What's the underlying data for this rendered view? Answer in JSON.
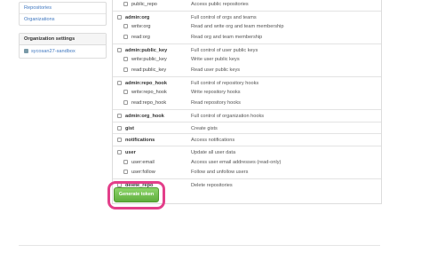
{
  "sidebar": {
    "nav_items": [
      "Repositories",
      "Organizations"
    ],
    "org_settings": {
      "heading": "Organization settings",
      "orgs": [
        "sycosan27-sandbox"
      ]
    }
  },
  "scopes": [
    {
      "name": "public_repo",
      "description": "Access public repositories",
      "level": "child"
    },
    {
      "name": "admin:org",
      "description": "Full control of orgs and teams",
      "level": "parent"
    },
    {
      "name": "write:org",
      "description": "Read and write org and team membership",
      "level": "child"
    },
    {
      "name": "read:org",
      "description": "Read org and team membership",
      "level": "child"
    },
    {
      "name": "admin:public_key",
      "description": "Full control of user public keys",
      "level": "parent"
    },
    {
      "name": "write:public_key",
      "description": "Write user public keys",
      "level": "child"
    },
    {
      "name": "read:public_key",
      "description": "Read user public keys",
      "level": "child"
    },
    {
      "name": "admin:repo_hook",
      "description": "Full control of repository hooks",
      "level": "parent"
    },
    {
      "name": "write:repo_hook",
      "description": "Write repository hooks",
      "level": "child"
    },
    {
      "name": "read:repo_hook",
      "description": "Read repository hooks",
      "level": "child"
    },
    {
      "name": "admin:org_hook",
      "description": "Full control of organization hooks",
      "level": "parent"
    },
    {
      "name": "gist",
      "description": "Create gists",
      "level": "parent"
    },
    {
      "name": "notifications",
      "description": "Access notifications",
      "level": "parent"
    },
    {
      "name": "user",
      "description": "Update all user data",
      "level": "parent"
    },
    {
      "name": "user:email",
      "description": "Access user email addresses (read-only)",
      "level": "child"
    },
    {
      "name": "user:follow",
      "description": "Follow and unfollow users",
      "level": "child"
    },
    {
      "name": "delete_repo",
      "description": "Delete repositories",
      "level": "parent"
    }
  ],
  "actions": {
    "generate_label": "Generate token"
  },
  "colors": {
    "link": "#4078c0",
    "button_green": "#6cc644",
    "highlight_pink": "#e33f8a"
  }
}
